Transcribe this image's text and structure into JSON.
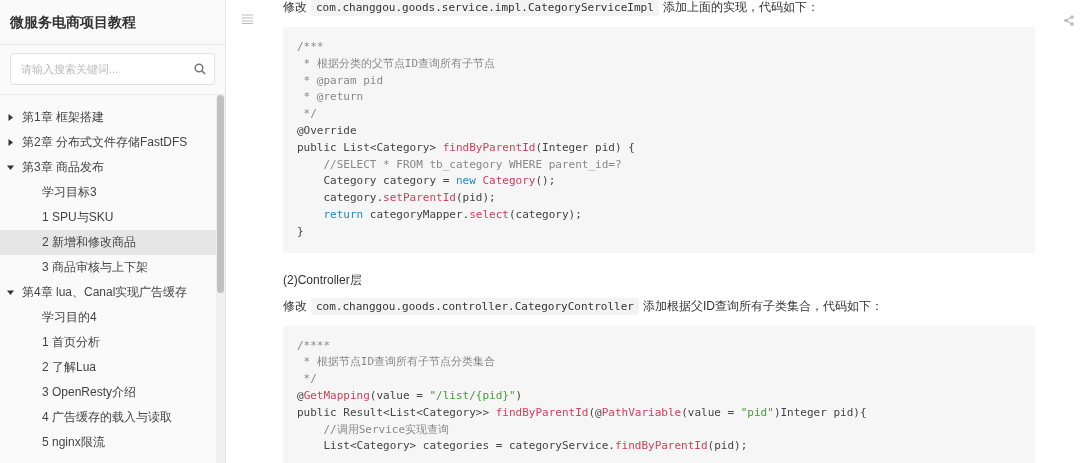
{
  "sidebar": {
    "title": "微服务电商项目教程",
    "search": {
      "placeholder": "请输入搜索关键词..."
    },
    "chapters": [
      {
        "label": "第1章 框架搭建",
        "expanded": false
      },
      {
        "label": "第2章 分布式文件存储FastDFS",
        "expanded": false
      },
      {
        "label": "第3章 商品发布",
        "expanded": true,
        "children": [
          {
            "label": "学习目标3",
            "selected": false
          },
          {
            "label": "1 SPU与SKU",
            "selected": false
          },
          {
            "label": "2 新增和修改商品",
            "selected": true
          },
          {
            "label": "3 商品审核与上下架",
            "selected": false
          }
        ]
      },
      {
        "label": "第4章 lua、Canal实现广告缓存",
        "expanded": true,
        "children": [
          {
            "label": "学习目的4",
            "selected": false
          },
          {
            "label": "1 首页分析",
            "selected": false
          },
          {
            "label": "2 了解Lua",
            "selected": false
          },
          {
            "label": "3 OpenResty介绍",
            "selected": false
          },
          {
            "label": "4 广告缓存的载入与读取",
            "selected": false
          },
          {
            "label": "5 nginx限流",
            "selected": false
          }
        ]
      }
    ]
  },
  "content": [
    {
      "kind": "para",
      "parts": [
        {
          "kind": "text",
          "text": "修改"
        },
        {
          "kind": "code",
          "text": "com.changgou.goods.service.impl.CategoryServiceImpl"
        },
        {
          "kind": "text",
          "text": "添加上面的实现，代码如下："
        }
      ]
    },
    {
      "kind": "codeblock",
      "lines": [
        [
          {
            "kind": "comment",
            "text": "/***"
          }
        ],
        [
          {
            "kind": "comment",
            "text": " * 根据分类的父节点ID查询所有子节点"
          }
        ],
        [
          {
            "kind": "comment",
            "text": " * @param pid"
          }
        ],
        [
          {
            "kind": "comment",
            "text": " * @return"
          }
        ],
        [
          {
            "kind": "comment",
            "text": " */"
          }
        ],
        [
          {
            "kind": "plain",
            "text": "@Override"
          }
        ],
        [
          {
            "kind": "plain",
            "text": "public List<Category> "
          },
          {
            "kind": "func",
            "text": "findByParentId"
          },
          {
            "kind": "plain",
            "text": "(Integer pid) {"
          }
        ],
        [
          {
            "kind": "comment",
            "text": "    //SELECT * FROM tb_category WHERE parent_id=?"
          }
        ],
        [
          {
            "kind": "plain",
            "text": "    Category category = "
          },
          {
            "kind": "keyword",
            "text": "new"
          },
          {
            "kind": "func",
            "text": " Category"
          },
          {
            "kind": "plain",
            "text": "();"
          }
        ],
        [
          {
            "kind": "plain",
            "text": "    category."
          },
          {
            "kind": "func",
            "text": "setParentId"
          },
          {
            "kind": "plain",
            "text": "(pid);"
          }
        ],
        [
          {
            "kind": "keyword",
            "text": "    return"
          },
          {
            "kind": "plain",
            "text": " categoryMapper."
          },
          {
            "kind": "func",
            "text": "select"
          },
          {
            "kind": "plain",
            "text": "(category);"
          }
        ],
        [
          {
            "kind": "plain",
            "text": "}"
          }
        ]
      ]
    },
    {
      "kind": "heading",
      "text": "(2)Controller层"
    },
    {
      "kind": "para",
      "parts": [
        {
          "kind": "text",
          "text": "修改"
        },
        {
          "kind": "code",
          "text": "com.changgou.goods.controller.CategoryController"
        },
        {
          "kind": "text",
          "text": "添加根据父ID查询所有子类集合，代码如下："
        }
      ]
    },
    {
      "kind": "codeblock",
      "lines": [
        [
          {
            "kind": "comment",
            "text": "/****"
          }
        ],
        [
          {
            "kind": "comment",
            "text": " * 根据节点ID查询所有子节点分类集合"
          }
        ],
        [
          {
            "kind": "comment",
            "text": " */"
          }
        ],
        [
          {
            "kind": "plain",
            "text": "@"
          },
          {
            "kind": "func",
            "text": "GetMapping"
          },
          {
            "kind": "plain",
            "text": "(value = "
          },
          {
            "kind": "string",
            "text": "\"/list/{pid}\""
          },
          {
            "kind": "plain",
            "text": ")"
          }
        ],
        [
          {
            "kind": "plain",
            "text": "public Result<List<Category>> "
          },
          {
            "kind": "func",
            "text": "findByParentId"
          },
          {
            "kind": "plain",
            "text": "(@"
          },
          {
            "kind": "func",
            "text": "PathVariable"
          },
          {
            "kind": "plain",
            "text": "(value = "
          },
          {
            "kind": "string",
            "text": "\"pid\""
          },
          {
            "kind": "plain",
            "text": ")Integer pid){"
          }
        ],
        [
          {
            "kind": "comment",
            "text": "    //调用Service实现查询"
          }
        ],
        [
          {
            "kind": "plain",
            "text": "    List<Category> categories = categoryService."
          },
          {
            "kind": "func",
            "text": "findByParentId"
          },
          {
            "kind": "plain",
            "text": "(pid);"
          }
        ]
      ]
    }
  ]
}
